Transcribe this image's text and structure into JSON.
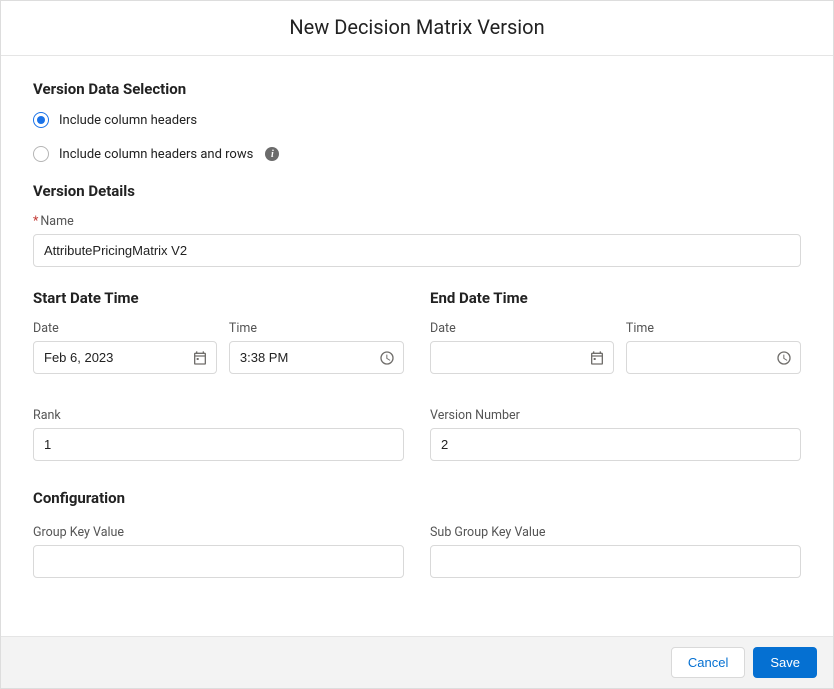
{
  "header": {
    "title": "New Decision Matrix Version"
  },
  "versionDataSelection": {
    "heading": "Version Data Selection",
    "option1": {
      "label": "Include column headers",
      "selected": true
    },
    "option2": {
      "label": "Include column headers and rows",
      "selected": false
    }
  },
  "versionDetails": {
    "heading": "Version Details",
    "name": {
      "label": "Name",
      "value": "AttributePricingMatrix V2"
    }
  },
  "startDateTime": {
    "heading": "Start Date Time",
    "dateLabel": "Date",
    "timeLabel": "Time",
    "dateValue": "Feb 6, 2023",
    "timeValue": "3:38 PM"
  },
  "endDateTime": {
    "heading": "End Date Time",
    "dateLabel": "Date",
    "timeLabel": "Time",
    "dateValue": "",
    "timeValue": ""
  },
  "rank": {
    "label": "Rank",
    "value": "1"
  },
  "versionNumber": {
    "label": "Version Number",
    "value": "2"
  },
  "configuration": {
    "heading": "Configuration",
    "groupKeyValue": {
      "label": "Group Key Value",
      "value": ""
    },
    "subGroupKeyValue": {
      "label": "Sub Group Key Value",
      "value": ""
    }
  },
  "footer": {
    "cancel": "Cancel",
    "save": "Save"
  }
}
